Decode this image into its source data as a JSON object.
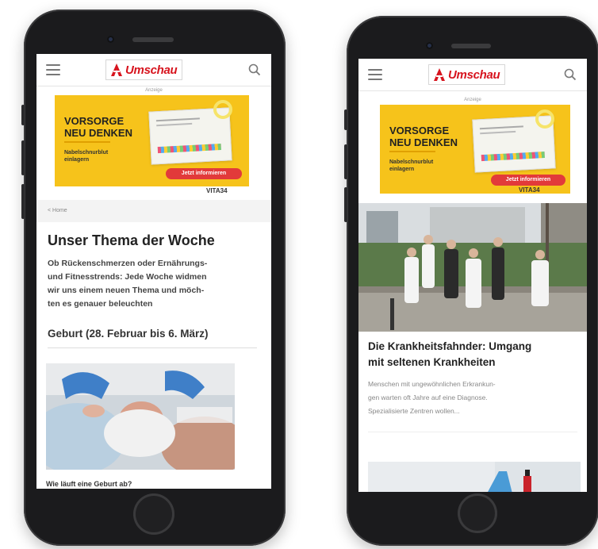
{
  "brand": {
    "name": "Umschau",
    "color": "#d7141e"
  },
  "ad": {
    "label": "Anzeige",
    "headline_1": "VORSORGE",
    "headline_2": "NEU DENKEN",
    "sub_1": "Nabelschnurblut",
    "sub_2": "einlagern",
    "cta": "Jetzt informieren",
    "brand": "VITA34",
    "colors": {
      "background": "#f6c31b",
      "cta": "#e23a3a"
    }
  },
  "left_phone": {
    "breadcrumb": "< Home",
    "title": "Unser Thema der Woche",
    "intro_lines": [
      "Ob Rückenschmerzen oder Ernährungs-",
      "und Fitnesstrends: Jede Woche widmen",
      "wir uns einem neuen Thema und möch-",
      "ten es genauer beleuchten"
    ],
    "section": "Geburt (28. Februar bis 6. März)",
    "teaser": "Wie läuft eine Geburt ab?"
  },
  "right_phone": {
    "article_title_lines": [
      "Die Krankheitsfahnder: Umgang",
      "mit seltenen Krankheiten"
    ],
    "article_desc_lines": [
      "Menschen mit ungewöhnlichen Erkrankun-",
      "gen warten oft Jahre auf eine Diagnose.",
      "Spezialisierte Zentren wollen..."
    ]
  },
  "icons": [
    "menu-icon",
    "search-icon",
    "apotheke-logo-icon"
  ]
}
